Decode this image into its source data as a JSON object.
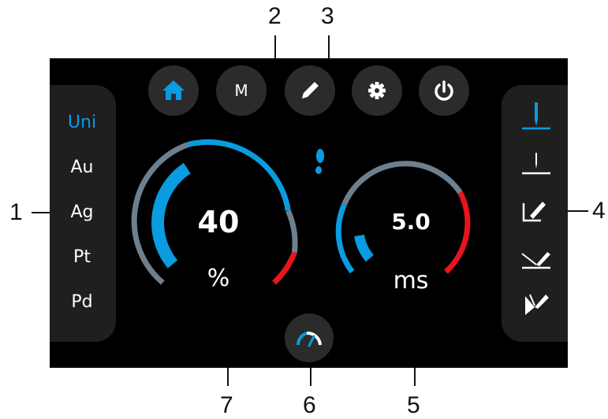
{
  "callouts": [
    "1",
    "2",
    "3",
    "4",
    "5",
    "6",
    "7"
  ],
  "metals": [
    "Uni",
    "Au",
    "Ag",
    "Pt",
    "Pd"
  ],
  "selected_metal": "Uni",
  "mode_button_label": "M",
  "power": {
    "value": "40",
    "unit": "%"
  },
  "pulse": {
    "value": "5.0",
    "unit": "ms"
  },
  "colors": {
    "accent": "#0a9be0",
    "gauge_track": "#6e7f8e",
    "warning": "#e8141e",
    "button_bg": "#2b2b2b",
    "panel_bg": "#1f1f1f"
  },
  "icons": {
    "top_buttons": [
      "home-icon",
      "mode-m-button",
      "pencil-icon",
      "gear-icon",
      "power-icon"
    ],
    "right_panel": [
      "weld-mode-1-icon",
      "weld-mode-2-icon",
      "weld-mode-3-icon",
      "weld-mode-4-icon",
      "weld-mode-5-icon"
    ],
    "indicator": "footprint-icon",
    "bottom_button": "speedometer-icon"
  }
}
